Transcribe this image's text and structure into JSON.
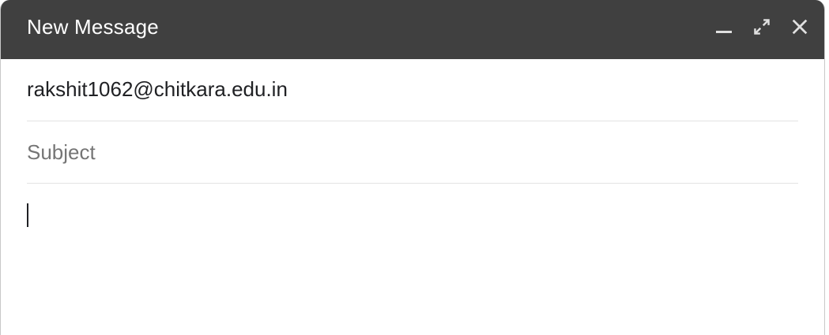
{
  "compose": {
    "title": "New Message",
    "header_icons": [
      "minimize-icon",
      "fullscreen-icon",
      "close-icon"
    ],
    "to": "rakshit1062@chitkara.edu.in",
    "subject_placeholder": "Subject",
    "subject_value": "",
    "body_text": ""
  },
  "colors": {
    "header_bg": "#404040",
    "header_text": "#ffffff",
    "placeholder": "#757575",
    "divider": "#e3e3e3"
  }
}
